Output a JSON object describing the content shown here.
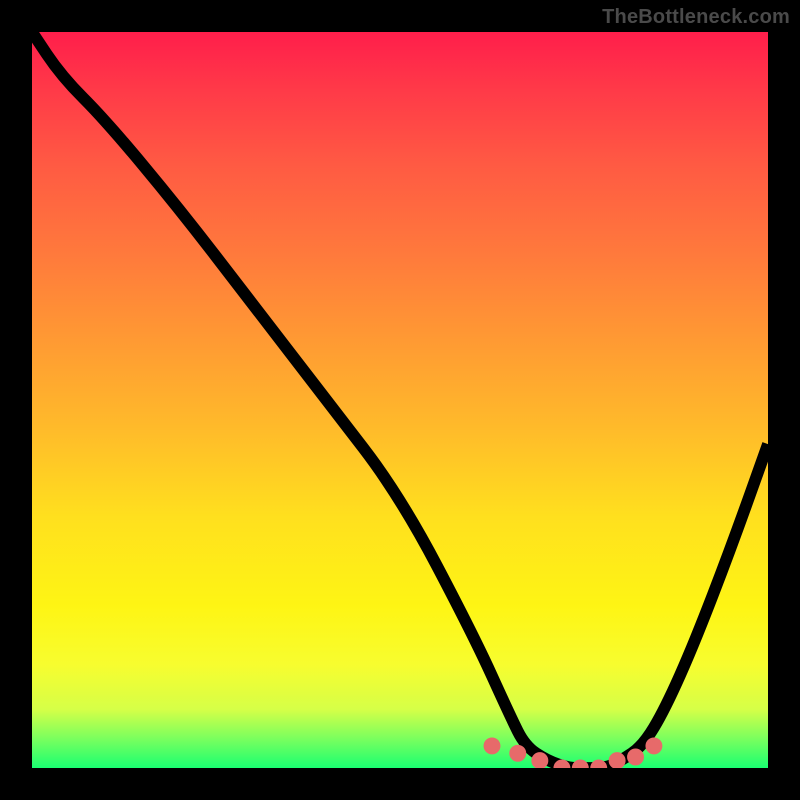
{
  "watermark": "TheBottleneck.com",
  "colors": {
    "page_bg": "#000000",
    "watermark_text": "#4a4a4a",
    "curve": "#000000",
    "markers": "#e76a6a",
    "gradient_stops": [
      "#ff1e4b",
      "#ff3a48",
      "#ff5a43",
      "#ff793c",
      "#ff9a33",
      "#ffbb2a",
      "#ffe01e",
      "#fef514",
      "#f7fd2f",
      "#d6ff47",
      "#7aff5e",
      "#1aff71"
    ]
  },
  "chart_data": {
    "type": "line",
    "title": "",
    "xlabel": "",
    "ylabel": "",
    "xlim": [
      0,
      100
    ],
    "ylim": [
      0,
      100
    ],
    "grid": false,
    "legend": false,
    "x": [
      0,
      4,
      10,
      20,
      30,
      40,
      50,
      60,
      65,
      67,
      70,
      73,
      75,
      78,
      80,
      83,
      86,
      90,
      95,
      100
    ],
    "series": [
      {
        "name": "curve",
        "values": [
          100,
          94,
          88,
          76,
          63,
          50,
          37,
          18,
          7,
          3,
          1,
          0,
          0,
          0,
          1,
          3,
          8,
          17,
          30,
          44
        ]
      }
    ],
    "marker_series": {
      "name": "trough-markers",
      "x": [
        62.5,
        66,
        69,
        72,
        74.5,
        77,
        79.5,
        82,
        84.5
      ],
      "y": [
        3,
        2,
        1,
        0,
        0,
        0,
        1,
        1.5,
        3
      ]
    }
  }
}
